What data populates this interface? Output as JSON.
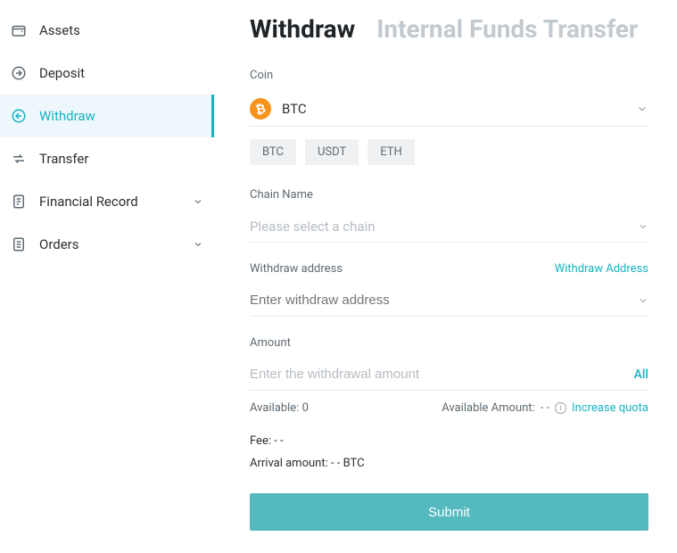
{
  "sidebar": {
    "items": [
      {
        "label": "Assets"
      },
      {
        "label": "Deposit"
      },
      {
        "label": "Withdraw"
      },
      {
        "label": "Transfer"
      },
      {
        "label": "Financial Record"
      },
      {
        "label": "Orders"
      }
    ]
  },
  "tabs": {
    "withdraw": "Withdraw",
    "internal": "Internal Funds Transfer"
  },
  "coin": {
    "label": "Coin",
    "selected": "BTC",
    "icon_glyph": "₿",
    "quick": [
      "BTC",
      "USDT",
      "ETH"
    ]
  },
  "chain": {
    "label": "Chain Name",
    "placeholder": "Please select a chain"
  },
  "address": {
    "label": "Withdraw address",
    "link": "Withdraw Address",
    "placeholder": "Enter withdraw address"
  },
  "amount": {
    "label": "Amount",
    "placeholder": "Enter the withdrawal amount",
    "all": "All",
    "available_label": "Available:",
    "available_value": "0",
    "avail_amount_label": "Available Amount:",
    "avail_amount_value": "- -",
    "increase_quota": "Increase quota"
  },
  "fee": {
    "label": "Fee:",
    "value": "- -"
  },
  "arrival": {
    "label": "Arrival amount:",
    "value": "- - BTC"
  },
  "submit": "Submit"
}
